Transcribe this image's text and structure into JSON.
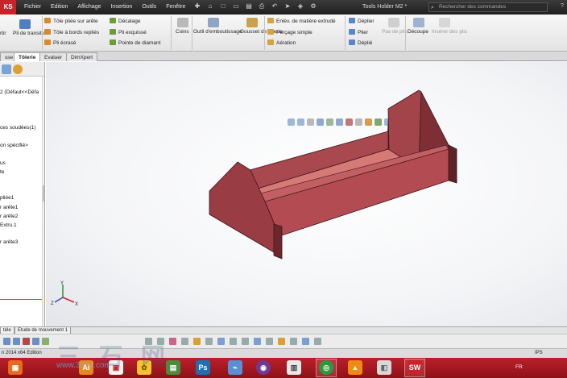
{
  "app": {
    "logo_text": "KS",
    "document_title": "Tools Holder M2 *"
  },
  "menu": [
    "Fichier",
    "Edition",
    "Affichage",
    "Insertion",
    "Outils",
    "Fenêtre"
  ],
  "search": {
    "placeholder": "Rechercher des commandes"
  },
  "ribbon": {
    "col0": [
      "rtir"
    ],
    "pli_transition": "Pli de transition",
    "col_a": [
      "Tôle pliée sur arête",
      "Tôle à bords repliés",
      "Pli écrasé"
    ],
    "col_b": [
      "Décalage",
      "Pli exquissé",
      "Pointe de diamant"
    ],
    "coins": "Coins",
    "outil_emboutissage": "Outil d'emboutissage",
    "gousset": "Gousset de tôlerie",
    "col_c": [
      "Enlèv. de matière extrudé",
      "Perçage simple",
      "Aération"
    ],
    "col_d": [
      "Déplier",
      "Plier",
      "Déplié"
    ],
    "pas_de_plis": "Pas de plis",
    "decoupe": "Découpe",
    "inserer_plis": "Insérer des plis"
  },
  "tabs": [
    "sse",
    "Tôlerie",
    "Evaluer",
    "DimXpert"
  ],
  "tree": [
    "2  (Défaut<<Défa",
    "ces soudées(1)",
    "on spécifié>",
    "us",
    "te",
    "pliée1",
    "r arête1",
    "r arête2",
    "Extru.1",
    "r arête3"
  ],
  "triad": {
    "x": "X",
    "y": "Y",
    "z": "Z"
  },
  "bottom_tabs": [
    "tèle",
    "Etude de mouvement 1"
  ],
  "status": {
    "left": "n 2014 x64 Edition",
    "right": "IPS"
  },
  "taskbar": {
    "ai_label": "Ai",
    "ps_label": "Ps",
    "sw_label": "SW",
    "lang": "FR"
  },
  "watermark": {
    "text": "三 石 网",
    "url": "www.3d3d.com"
  },
  "colors": {
    "part": "#a8434a",
    "part_light": "#c85a5e",
    "part_dark": "#7a2b31",
    "taskbar": "#b11d26",
    "topbar": "#2a2a2a"
  }
}
